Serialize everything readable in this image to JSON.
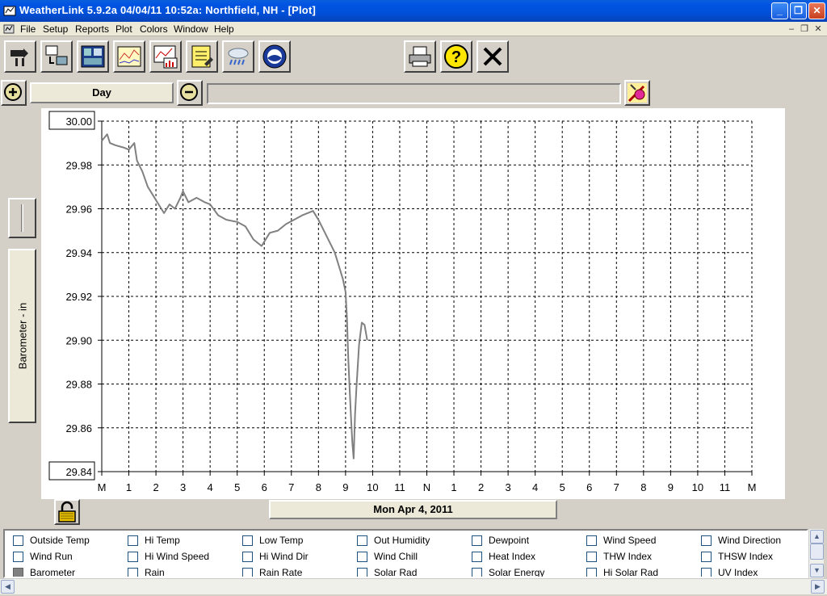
{
  "window": {
    "title": "WeatherLink 5.9.2a  04/04/11  10:52a: Northfield, NH - [Plot]",
    "controls": [
      "minimize",
      "restore",
      "close"
    ]
  },
  "menu": {
    "items": [
      "File",
      "Setup",
      "Reports",
      "Plot",
      "Colors",
      "Window",
      "Help"
    ]
  },
  "toolbar": {
    "left_buttons": [
      "bulletin-icon",
      "download-icon",
      "station-icon",
      "plot-icon",
      "graph-icon",
      "notes-icon",
      "weather-icon",
      "noaa-icon"
    ],
    "right_buttons": [
      "print-icon",
      "help-icon",
      "close-icon"
    ]
  },
  "plot_controls": {
    "period": "Day",
    "zoom_in": "+",
    "zoom_out": "−"
  },
  "axis_title": "Barometer - in",
  "date_label": "Mon Apr 4, 2011",
  "chart_data": {
    "type": "line",
    "title": "",
    "xlabel": "Mon Apr 4, 2011",
    "ylabel": "Barometer - in",
    "ylim": [
      29.84,
      30.0
    ],
    "y_ticks": [
      "30.00",
      "29.98",
      "29.96",
      "29.94",
      "29.92",
      "29.90",
      "29.88",
      "29.86",
      "29.84"
    ],
    "x_ticks": [
      "M",
      "1",
      "2",
      "3",
      "4",
      "5",
      "6",
      "7",
      "8",
      "9",
      "10",
      "11",
      "N",
      "1",
      "2",
      "3",
      "4",
      "5",
      "6",
      "7",
      "8",
      "9",
      "10",
      "11",
      "M"
    ],
    "grid": true,
    "line_color": "#808080",
    "series": [
      {
        "x_hours": [
          0.0,
          0.2,
          0.3,
          0.5,
          0.8,
          1.0,
          1.2,
          1.3,
          1.5,
          1.7,
          1.9,
          2.1,
          2.3,
          2.5,
          2.7,
          2.9,
          3.0,
          3.2,
          3.5,
          3.8,
          4.0,
          4.3,
          4.6,
          5.0,
          5.3,
          5.6,
          5.9,
          6.2,
          6.5,
          6.8,
          7.1,
          7.4,
          7.6,
          7.8,
          8.0,
          8.2,
          8.4,
          8.6,
          8.8,
          8.9,
          9.0,
          9.05,
          9.1,
          9.15,
          9.2,
          9.25,
          9.3,
          9.35,
          9.4,
          9.5,
          9.6,
          9.7,
          9.8
        ],
        "values": [
          29.991,
          29.994,
          29.99,
          29.989,
          29.988,
          29.987,
          29.99,
          29.982,
          29.977,
          29.97,
          29.966,
          29.962,
          29.958,
          29.962,
          29.96,
          29.965,
          29.968,
          29.963,
          29.965,
          29.963,
          29.962,
          29.957,
          29.955,
          29.954,
          29.952,
          29.946,
          29.943,
          29.949,
          29.95,
          29.953,
          29.955,
          29.957,
          29.958,
          29.959,
          29.955,
          29.95,
          29.945,
          29.94,
          29.932,
          29.928,
          29.922,
          29.91,
          29.892,
          29.878,
          29.865,
          29.853,
          29.846,
          29.866,
          29.878,
          29.898,
          29.908,
          29.907,
          29.9
        ]
      }
    ]
  },
  "checklist": {
    "items": [
      {
        "label": "Outside Temp",
        "checked": false
      },
      {
        "label": "Hi Temp",
        "checked": false
      },
      {
        "label": "Low Temp",
        "checked": false
      },
      {
        "label": "Out Humidity",
        "checked": false
      },
      {
        "label": "Dewpoint",
        "checked": false
      },
      {
        "label": "Wind Speed",
        "checked": false
      },
      {
        "label": "Wind Direction",
        "checked": false
      },
      {
        "label": "Wind Run",
        "checked": false
      },
      {
        "label": "Hi Wind Speed",
        "checked": false
      },
      {
        "label": "Hi Wind Dir",
        "checked": false
      },
      {
        "label": "Wind Chill",
        "checked": false
      },
      {
        "label": "Heat Index",
        "checked": false
      },
      {
        "label": "THW Index",
        "checked": false
      },
      {
        "label": "THSW Index",
        "checked": false
      },
      {
        "label": "Barometer",
        "checked": true
      },
      {
        "label": "Rain",
        "checked": false
      },
      {
        "label": "Rain Rate",
        "checked": false
      },
      {
        "label": "Solar Rad",
        "checked": false
      },
      {
        "label": "Solar Energy",
        "checked": false
      },
      {
        "label": "Hi Solar Rad",
        "checked": false
      },
      {
        "label": "UV Index",
        "checked": false
      }
    ]
  }
}
